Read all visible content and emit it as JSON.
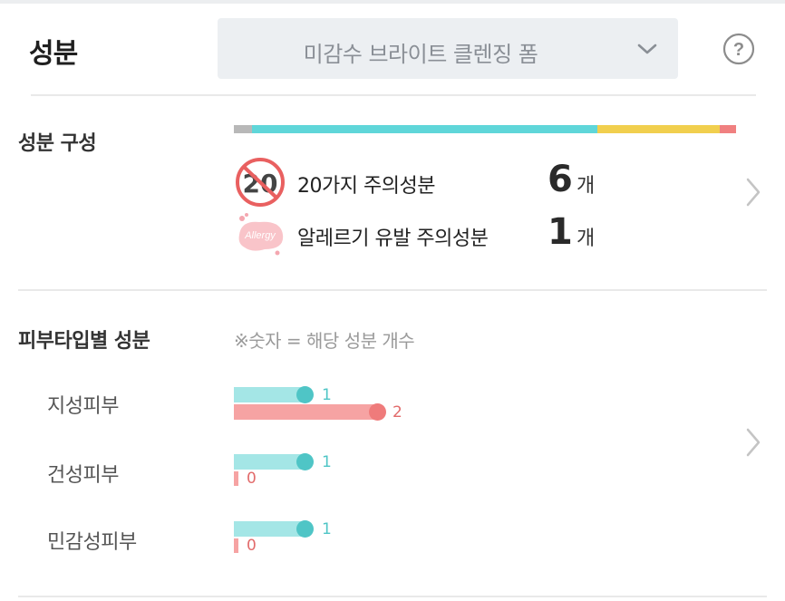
{
  "header": {
    "title": "성분",
    "product_select": "미감수 브라이트 클렌징 폼",
    "help_icon": "question-circle-icon",
    "chevron_icon": "chevron-down-icon"
  },
  "composition": {
    "title": "성분 구성",
    "bar_colors": [
      "#b8b8b8",
      "#5fd6d9",
      "#f1cf4e",
      "#f08080"
    ],
    "rows": [
      {
        "icon": "no-20-icon",
        "icon_text": "20",
        "label": "20가지 주의성분",
        "count": "6",
        "unit": "개"
      },
      {
        "icon": "allergy-icon",
        "icon_text": "Allergy",
        "label": "알레르기 유발 주의성분",
        "count": "1",
        "unit": "개"
      }
    ]
  },
  "skin_types": {
    "title": "피부타입별 성분",
    "note": "※숫자 = 해당 성분 개수",
    "colors": {
      "good": "#4fc5c6",
      "bad": "#ef7b7b"
    },
    "items": [
      {
        "label": "지성피부",
        "good": "1",
        "bad": "2"
      },
      {
        "label": "건성피부",
        "good": "1",
        "bad": "0"
      },
      {
        "label": "민감성피부",
        "good": "1",
        "bad": "0"
      }
    ]
  }
}
